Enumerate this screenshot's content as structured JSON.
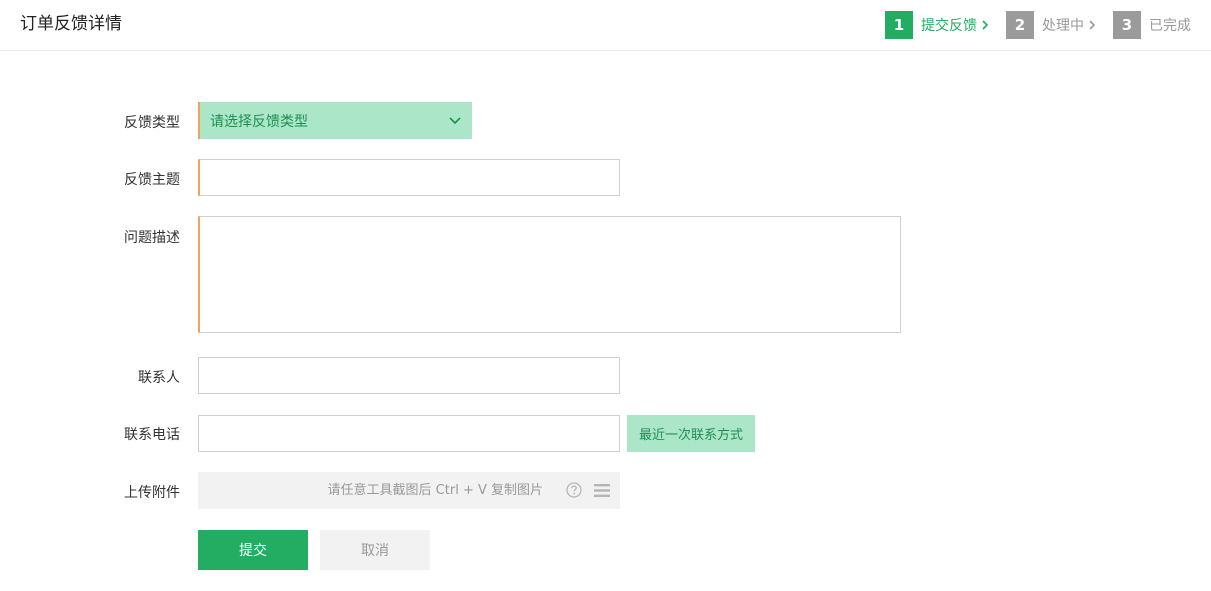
{
  "page": {
    "title": "订单反馈详情"
  },
  "steps": [
    {
      "num": "1",
      "label": "提交反馈",
      "active": true
    },
    {
      "num": "2",
      "label": "处理中",
      "active": false
    },
    {
      "num": "3",
      "label": "已完成",
      "active": false
    }
  ],
  "form": {
    "type_label": "反馈类型",
    "type_placeholder": "请选择反馈类型",
    "subject_label": "反馈主题",
    "subject_value": "",
    "description_label": "问题描述",
    "description_value": "",
    "contact_label": "联系人",
    "contact_value": "",
    "phone_label": "联系电话",
    "phone_value": "",
    "recent_contact_button": "最近一次联系方式",
    "attachment_label": "上传附件",
    "attachment_hint": "请任意工具截图后 Ctrl + V 复制图片",
    "submit_button": "提交",
    "cancel_button": "取消"
  },
  "icons": {
    "step_separator": "chevron-right-icon",
    "select_toggle": "chevron-down-icon",
    "help": "question-circle-icon",
    "menu": "menu-icon"
  },
  "colors": {
    "accent": "#22ad62",
    "accent_light": "#abe6c8",
    "required_marker": "#f0a35e",
    "inactive_step": "#9b9b9b"
  }
}
